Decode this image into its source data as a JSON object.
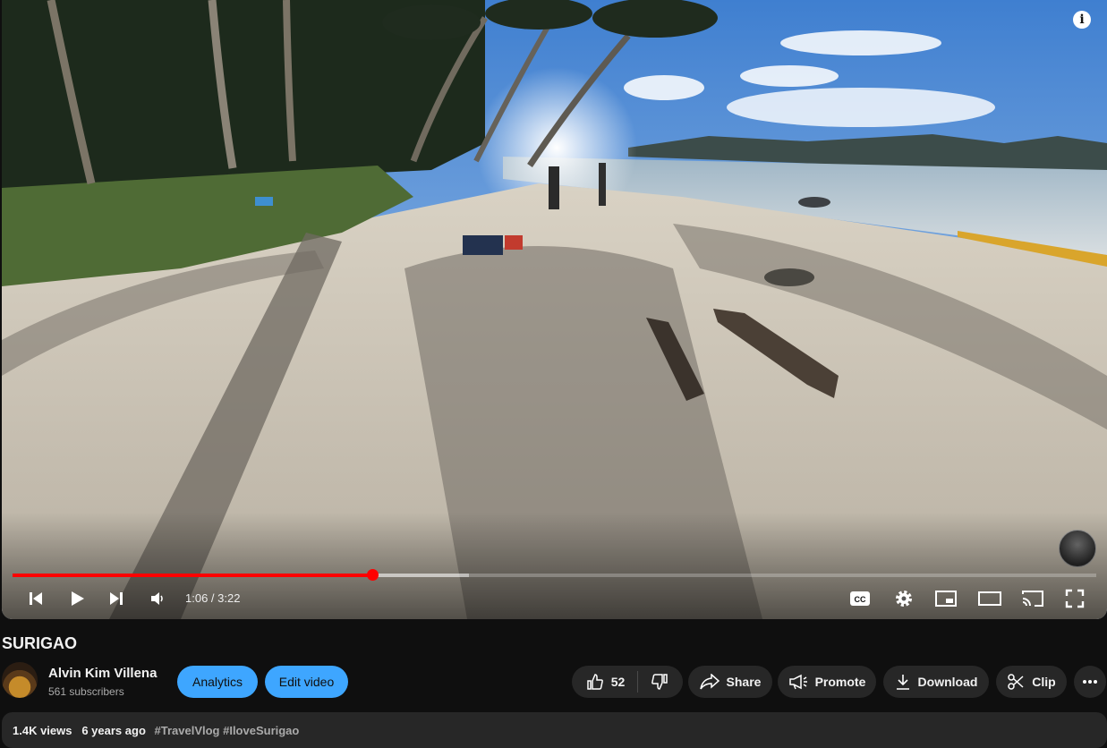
{
  "player": {
    "info_icon": "i",
    "time_current": "1:06",
    "time_total": "3:22",
    "time_separator": " / ",
    "progress_played_fraction": 0.332,
    "progress_buffered_fraction": 0.421,
    "accent_color": "#ff0000",
    "controls": {
      "prev": "skip-previous-icon",
      "play": "play-icon",
      "next": "skip-next-icon",
      "volume": "volume-icon",
      "cc": "CC",
      "settings": "gear-icon",
      "miniplayer": "miniplayer-icon",
      "theater": "theater-mode-icon",
      "cast": "cast-icon",
      "fullscreen": "fullscreen-icon"
    }
  },
  "video": {
    "title": "SURIGAO"
  },
  "channel": {
    "name": "Alvin Kim Villena",
    "subscribers": "561 subscribers"
  },
  "actions": {
    "analytics": "Analytics",
    "edit_video": "Edit video",
    "likes": "52",
    "share": "Share",
    "promote": "Promote",
    "download": "Download",
    "clip": "Clip"
  },
  "description": {
    "views": "1.4K views",
    "age": "6 years ago",
    "tags": "#TravelVlog #IloveSurigao"
  }
}
